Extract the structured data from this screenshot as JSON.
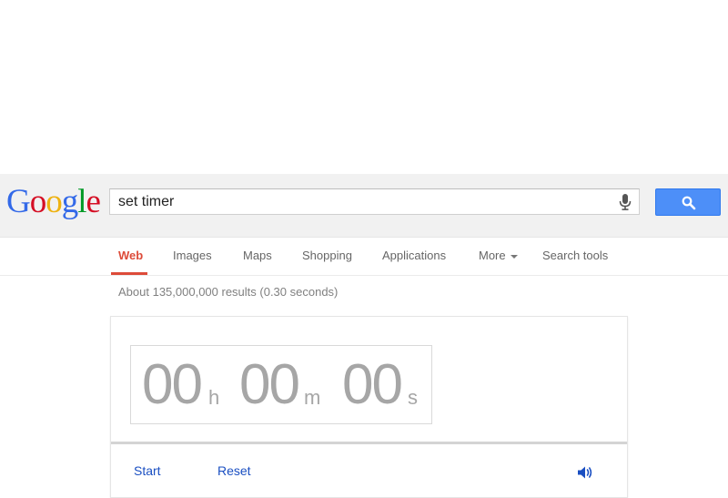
{
  "logo": {
    "letters": [
      "G",
      "o",
      "o",
      "g",
      "l",
      "e"
    ]
  },
  "search": {
    "query": "set timer",
    "mic_icon": "microphone-icon",
    "button_icon": "magnifier-icon"
  },
  "nav": {
    "tabs": [
      {
        "label": "Web",
        "active": true
      },
      {
        "label": "Images"
      },
      {
        "label": "Maps"
      },
      {
        "label": "Shopping"
      },
      {
        "label": "Applications"
      },
      {
        "label": "More"
      },
      {
        "label": "Search tools"
      }
    ]
  },
  "results": {
    "stats": "About 135,000,000 results (0.30 seconds)"
  },
  "timer": {
    "hours": "00",
    "hours_unit": "h",
    "minutes": "00",
    "minutes_unit": "m",
    "seconds": "00",
    "seconds_unit": "s",
    "start_label": "Start",
    "reset_label": "Reset",
    "volume_icon": "speaker-icon"
  },
  "colors": {
    "accent_red": "#dd4b39",
    "search_blue": "#4d8ff8",
    "link_blue": "#1a4fc2",
    "logo": [
      "#3369e8",
      "#d50f25",
      "#eeb211",
      "#3369e8",
      "#009925",
      "#d50f25"
    ]
  }
}
